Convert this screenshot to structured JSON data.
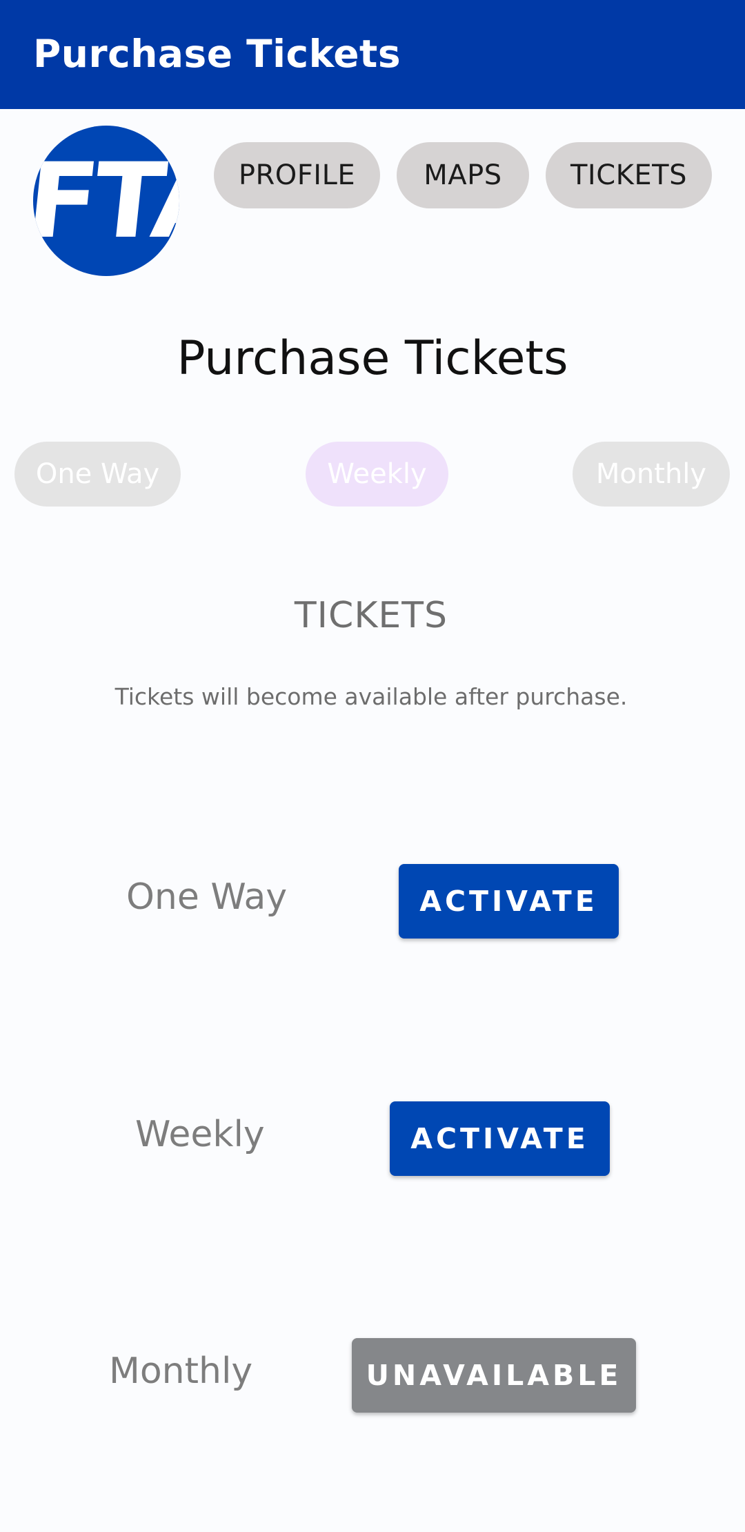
{
  "app_bar": {
    "title": "Purchase Tickets",
    "color": "#0039A6"
  },
  "logo": {
    "text": "FTA",
    "color": "#0046B4"
  },
  "nav": {
    "profile": "PROFILE",
    "maps": "MAPS",
    "tickets": "TICKETS"
  },
  "page_title": "Purchase Tickets",
  "ticket_types": {
    "one_way": "One Way",
    "weekly": "Weekly",
    "monthly": "Monthly",
    "selected": "Weekly"
  },
  "tickets_section": {
    "title": "TICKETS",
    "helper": "Tickets will become available after purchase."
  },
  "tickets": [
    {
      "label": "One Way",
      "action": "ACTIVATE",
      "status": "available"
    },
    {
      "label": "Weekly",
      "action": "ACTIVATE",
      "status": "available"
    },
    {
      "label": "Monthly",
      "action": "UNAVAILABLE",
      "status": "unavailable"
    }
  ],
  "colors": {
    "accent": "#0047B3",
    "disabled": "#85878A",
    "selected_pill": "#EFE1FB"
  }
}
